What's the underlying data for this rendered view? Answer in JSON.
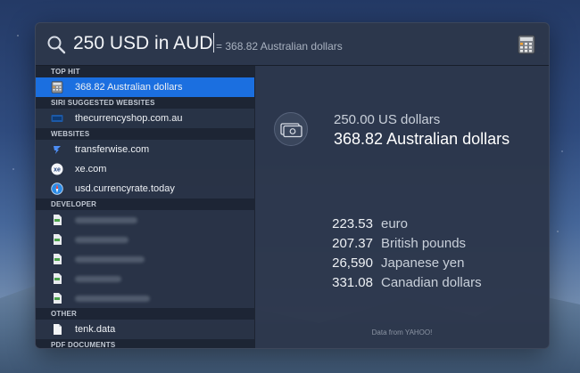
{
  "search": {
    "query": "250 USD in AUD",
    "completion": "= 368.82 Australian dollars"
  },
  "sections": {
    "top_hit": "TOP HIT",
    "siri": "SIRI SUGGESTED WEBSITES",
    "websites": "WEBSITES",
    "developer": "DEVELOPER",
    "other": "OTHER",
    "pdf": "PDF DOCUMENTS"
  },
  "results": {
    "top_hit": {
      "label": "368.82 Australian dollars",
      "icon": "calculator-icon"
    },
    "siri_site": {
      "label": "thecurrencyshop.com.au",
      "icon": "website-icon"
    },
    "websites": [
      {
        "label": "transferwise.com",
        "icon": "transferwise-icon"
      },
      {
        "label": "xe.com",
        "icon": "xe-icon"
      },
      {
        "label": "usd.currencyrate.today",
        "icon": "compass-icon"
      }
    ],
    "other": {
      "label": "tenk.data",
      "icon": "document-icon"
    }
  },
  "detail": {
    "from": "250.00 US dollars",
    "to": "368.82 Australian dollars",
    "conversions": [
      {
        "amount": "223.53",
        "currency": "euro"
      },
      {
        "amount": "207.37",
        "currency": "British pounds"
      },
      {
        "amount": "26,590",
        "currency": "Japanese yen"
      },
      {
        "amount": "331.08",
        "currency": "Canadian dollars"
      }
    ],
    "source": "Data from YAHOO!"
  },
  "colors": {
    "selection": "#1b6fe0",
    "panel": "#2c374b"
  }
}
